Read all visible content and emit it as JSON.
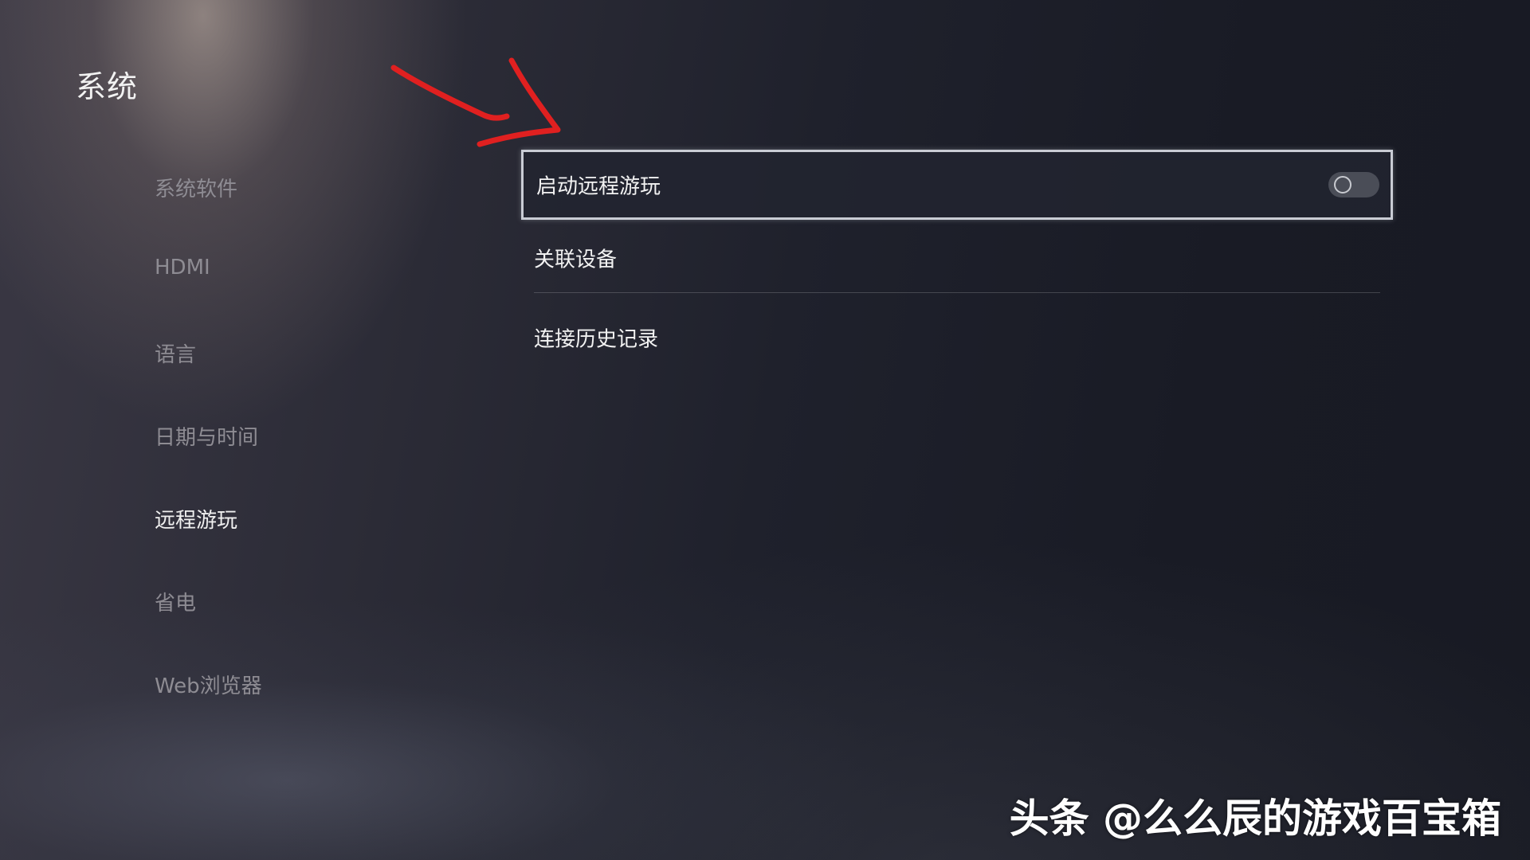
{
  "page": {
    "title": "系统"
  },
  "sidebar": {
    "items": [
      {
        "label": "系统软件",
        "active": false
      },
      {
        "label": "HDMI",
        "active": false
      },
      {
        "label": "语言",
        "active": false
      },
      {
        "label": "日期与时间",
        "active": false
      },
      {
        "label": "远程游玩",
        "active": true
      },
      {
        "label": "省电",
        "active": false
      },
      {
        "label": "Web浏览器",
        "active": false
      }
    ]
  },
  "settings": {
    "rows": [
      {
        "label": "启动远程游玩",
        "has_toggle": true,
        "toggle_on": false,
        "focused": true
      },
      {
        "label": "关联设备",
        "has_toggle": false,
        "focused": false
      },
      {
        "label": "连接历史记录",
        "has_toggle": false,
        "focused": false
      }
    ]
  },
  "annotation": {
    "arrow_color": "#e02020",
    "icon": "red-arrow-annotation"
  },
  "watermark": {
    "text": "头条 @么么辰的游戏百宝箱"
  },
  "colors": {
    "focus_border": "#c9ccd4",
    "inactive_text": "#8e8c93",
    "active_text": "#f0f0f0"
  }
}
